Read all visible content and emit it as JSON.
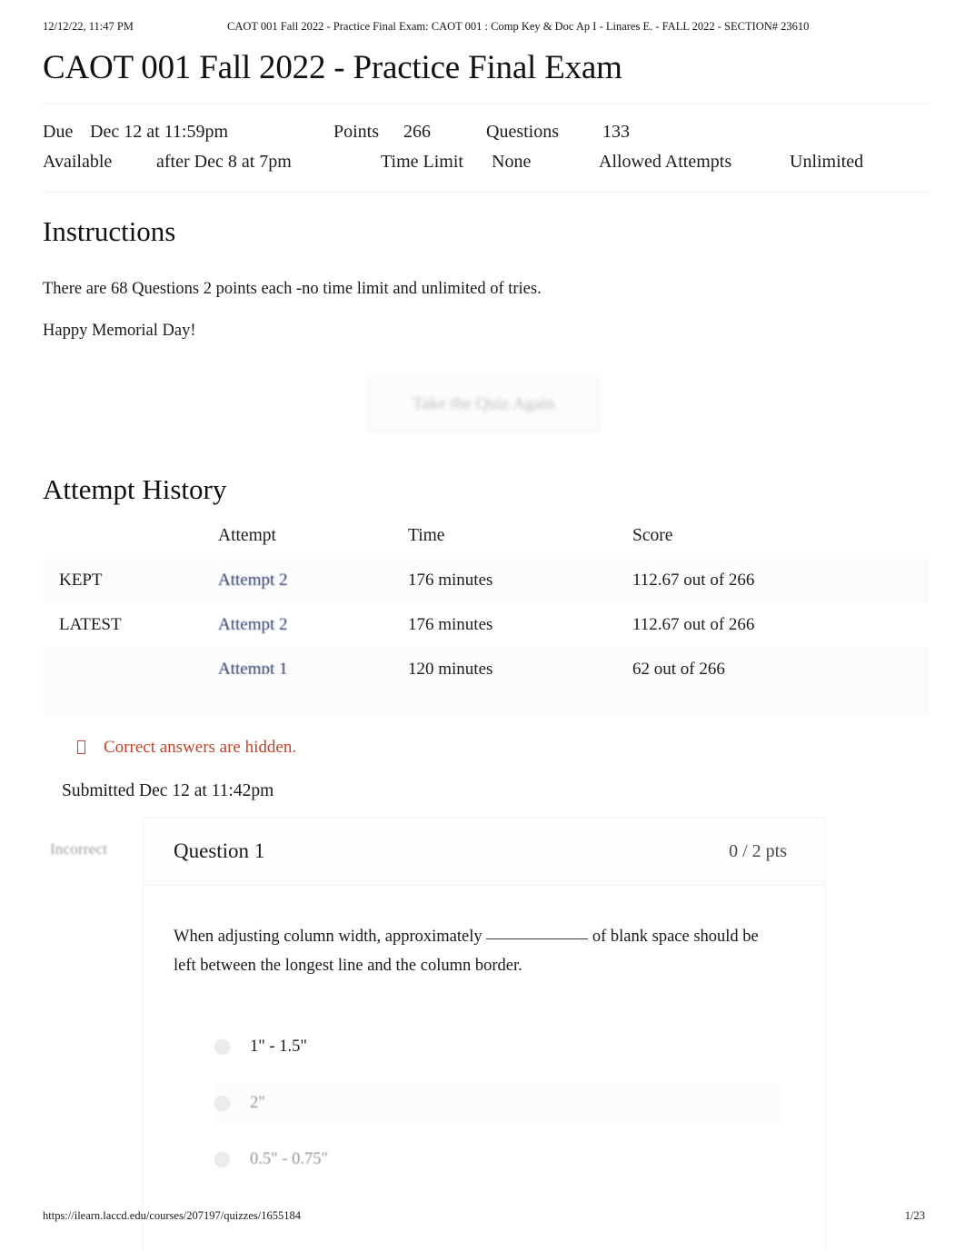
{
  "print_header": {
    "date": "12/12/22, 11:47 PM",
    "title": "CAOT 001 Fall 2022 - Practice Final Exam: CAOT 001 : Comp Key & Doc Ap I - Linares E. - FALL 2022 - SECTION# 23610"
  },
  "page_title": "CAOT 001 Fall 2022 - Practice Final Exam",
  "quiz_meta": {
    "due_label": "Due",
    "due_value": "Dec 12 at 11:59pm",
    "points_label": "Points",
    "points_value": "266",
    "questions_label": "Questions",
    "questions_value": "133",
    "available_label": "Available",
    "available_value": "after Dec 8 at 7pm",
    "time_limit_label": "Time Limit",
    "time_limit_value": "None",
    "allowed_attempts_label": "Allowed Attempts",
    "allowed_attempts_value": "Unlimited"
  },
  "instructions": {
    "heading": "Instructions",
    "line1": "There are 68 Questions 2 points each -no time limit and unlimited of tries.",
    "line2": "Happy Memorial Day!"
  },
  "retake_button": {
    "label": "Take the Quiz Again"
  },
  "attempt_history": {
    "heading": "Attempt History",
    "columns": [
      "",
      "Attempt",
      "Time",
      "Score"
    ],
    "rows": [
      {
        "flag": "KEPT",
        "attempt": "Attempt 2",
        "time": "176 minutes",
        "score": "112.67 out of 266"
      },
      {
        "flag": "LATEST",
        "attempt": "Attempt 2",
        "time": "176 minutes",
        "score": "112.67 out of 266"
      },
      {
        "flag": "",
        "attempt": "Attempt 1",
        "time": "120 minutes",
        "score": "62 out of 266"
      }
    ]
  },
  "notice": {
    "icon": "warning-box-icon",
    "text": "Correct answers are hidden.",
    "color": "#c1452a"
  },
  "submitted": "Submitted Dec 12 at 11:42pm",
  "question": {
    "status": "Incorrect",
    "title": "Question 1",
    "points": "0 / 2 pts",
    "text_before_blank": "When adjusting column width, approximately",
    "text_after_blank": "of blank space should be left between the longest line and the column border.",
    "answers": [
      {
        "label": "1\" - 1.5\"",
        "faded": false
      },
      {
        "label": "2\"",
        "faded": true
      },
      {
        "label": "0.5\" - 0.75\"",
        "faded": true
      }
    ]
  },
  "print_footer": {
    "url": "https://ilearn.laccd.edu/courses/207197/quizzes/1655184",
    "page": "1/23"
  },
  "colors": {
    "link": "#2c3a6b",
    "notice": "#c1452a",
    "text": "#1a1a1a"
  }
}
